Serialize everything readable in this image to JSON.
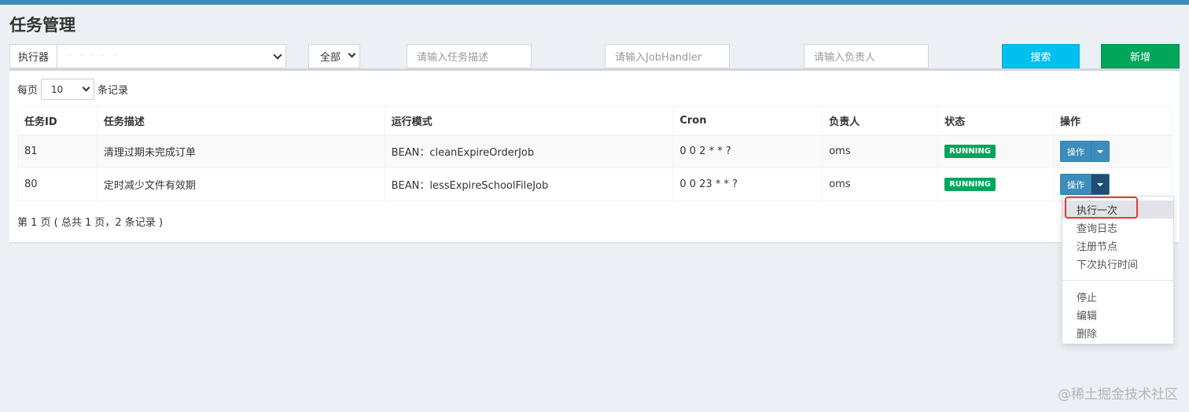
{
  "page": {
    "title": "任务管理"
  },
  "filters": {
    "executor_label": "执行器",
    "executor_value": "· · · · ·",
    "status_value": "全部",
    "job_desc_placeholder": "请输入任务描述",
    "job_handler_placeholder": "请输入JobHandler",
    "author_placeholder": "请输入负责人",
    "search_label": "搜索",
    "add_label": "新增"
  },
  "list": {
    "page_size_prefix": "每页",
    "page_size_value": "10",
    "page_size_suffix": "条记录",
    "columns": [
      "任务ID",
      "任务描述",
      "运行模式",
      "Cron",
      "负责人",
      "状态",
      "操作"
    ],
    "rows": [
      {
        "id": "81",
        "desc": "清理过期未完成订单",
        "mode": "BEAN：cleanExpireOrderJob",
        "cron": "0 0 2 * * ?",
        "author": "oms",
        "status": "RUNNING",
        "op": "操作"
      },
      {
        "id": "80",
        "desc": "定时减少文件有效期",
        "mode": "BEAN：lessExpireSchoolFileJob",
        "cron": "0 0 23 * * ?",
        "author": "oms",
        "status": "RUNNING",
        "op": "操作"
      }
    ],
    "pagination_info": "第 1 页 ( 总共 1 页，2 条记录 )"
  },
  "dropdown": {
    "items_group1": [
      "执行一次",
      "查询日志",
      "注册节点",
      "下次执行时间"
    ],
    "items_group2": [
      "停止",
      "编辑",
      "删除"
    ]
  },
  "watermark": "@稀土掘金技术社区",
  "colors": {
    "search": "#00c0ef",
    "add": "#00a65a",
    "primary": "#3c8dbc",
    "highlight": "#e53935"
  }
}
